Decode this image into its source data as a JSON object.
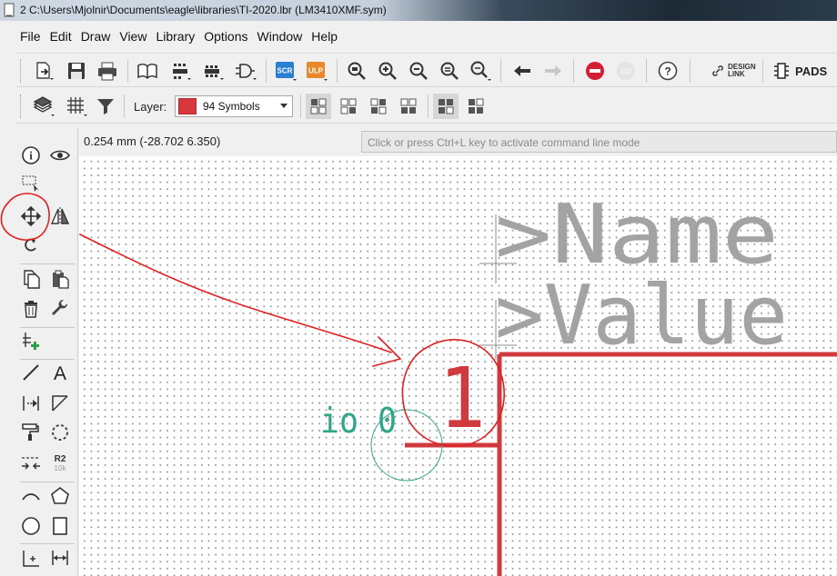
{
  "window": {
    "title": "2 C:\\Users\\Mjolnir\\Documents\\eagle\\libraries\\TI-2020.lbr (LM3410XMF.sym)"
  },
  "menu": [
    "File",
    "Edit",
    "Draw",
    "View",
    "Library",
    "Options",
    "Window",
    "Help"
  ],
  "toolbar": {
    "scr_label": "SCR",
    "ulp_label": "ULP",
    "go_label": "GO",
    "design_link_line1": "DESIGN",
    "design_link_line2": "LINK",
    "pads_label": "PADS"
  },
  "layer": {
    "label": "Layer:",
    "selected": "94 Symbols",
    "color": "#d8373d"
  },
  "status": {
    "coords": "0.254 mm (-28.702 6.350)",
    "command_placeholder": "Click or press Ctrl+L key to activate command line mode"
  },
  "left_tools": {
    "r2_label": "R2",
    "r2_sub": "10k",
    "text_tool_glyph": "A"
  },
  "canvas": {
    "name_text": ">Name",
    "value_text": ">Value",
    "pin_number": "1",
    "pin_name": "io 0",
    "colors": {
      "pin": "#d0393e",
      "pin_label": "#2fa68a",
      "placeholder": "#a0a0a0",
      "annotation": "#e02020"
    }
  }
}
